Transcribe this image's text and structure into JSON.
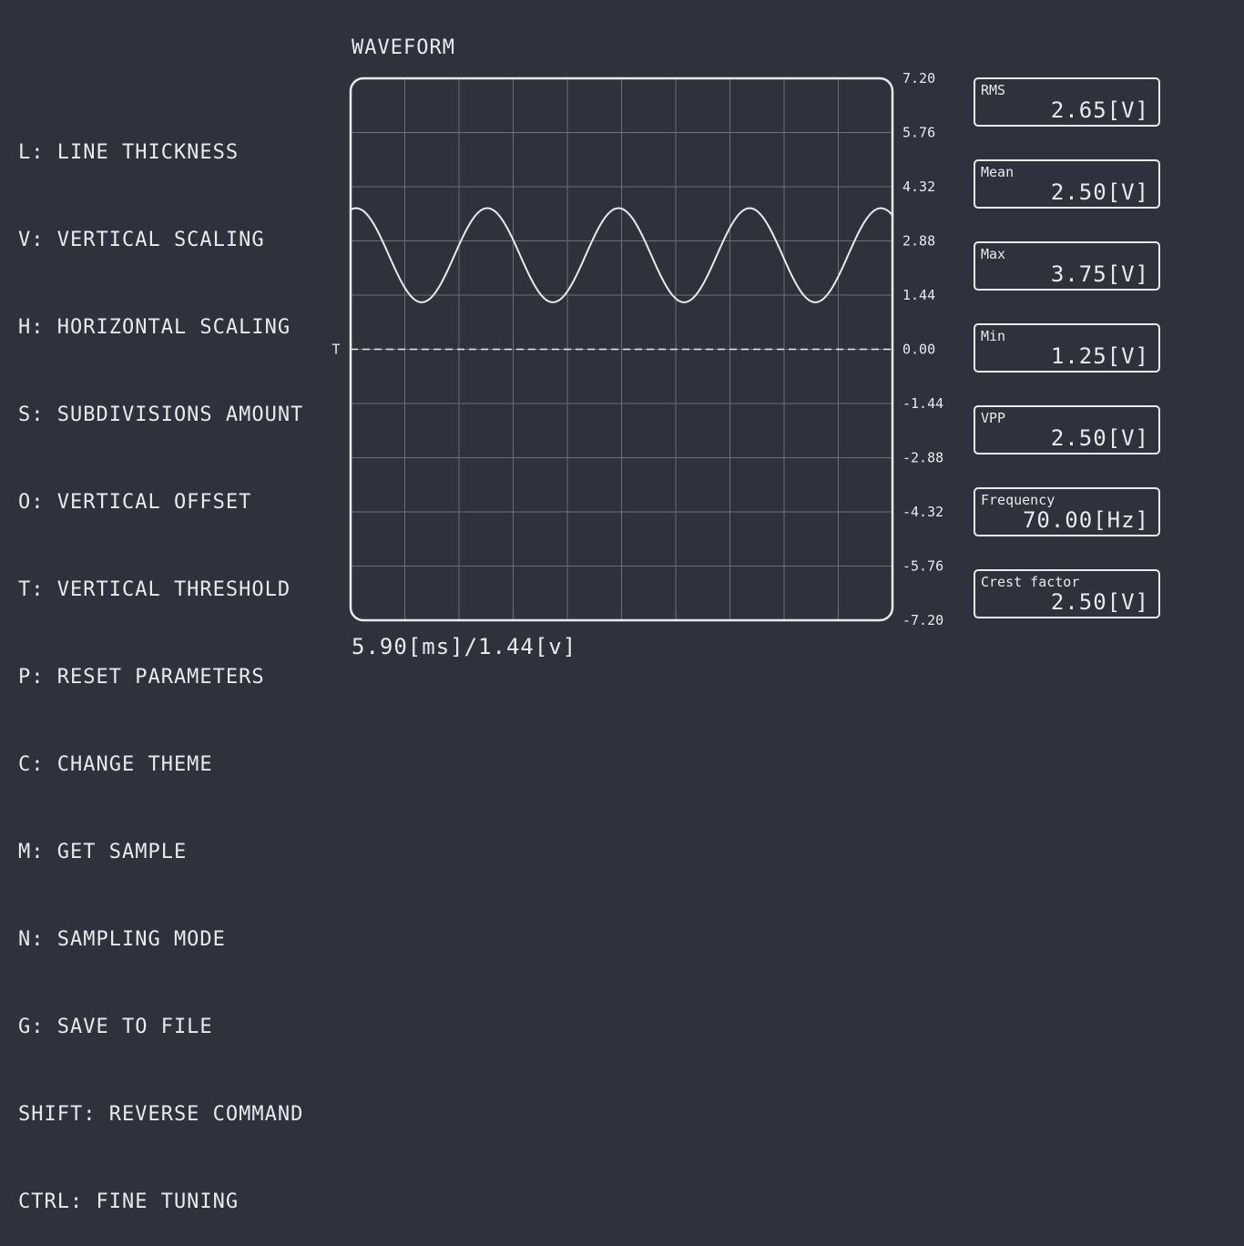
{
  "help_commands": [
    "L: LINE THICKNESS",
    "V: VERTICAL SCALING",
    "H: HORIZONTAL SCALING",
    "S: SUBDIVISIONS AMOUNT",
    "O: VERTICAL OFFSET",
    "T: VERTICAL THRESHOLD",
    "P: RESET PARAMETERS",
    "C: CHANGE THEME",
    "M: GET SAMPLE",
    "N: SAMPLING MODE",
    "G: SAVE TO FILE",
    "SHIFT: REVERSE COMMAND",
    "CTRL: FINE TUNING"
  ],
  "waveform": {
    "title": "WAVEFORM",
    "threshold_marker": "T",
    "scale_readout": "5.90[ms]/1.44[v]",
    "y_ticks": [
      "7.20",
      "5.76",
      "4.32",
      "2.88",
      "1.44",
      "0.00",
      "-1.44",
      "-2.88",
      "-4.32",
      "-5.76",
      "-7.20"
    ]
  },
  "chart_data": {
    "type": "line",
    "title": "WAVEFORM",
    "xlabel": "",
    "ylabel": "",
    "ylim": [
      -7.2,
      7.2
    ],
    "x_divisions": 10,
    "time_per_division_ms": 5.9,
    "volts_per_division": 1.44,
    "grid": true,
    "threshold": 0.0,
    "series": [
      {
        "waveform": "sine",
        "offset": 2.5,
        "amplitude": 1.25,
        "frequency_hz": 70.0,
        "phase_deg": 75
      }
    ]
  },
  "stats": [
    {
      "label": "RMS",
      "value": "2.65[V]"
    },
    {
      "label": "Mean",
      "value": "2.50[V]"
    },
    {
      "label": "Max",
      "value": "3.75[V]"
    },
    {
      "label": "Min",
      "value": "1.25[V]"
    },
    {
      "label": "VPP",
      "value": "2.50[V]"
    },
    {
      "label": "Frequency",
      "value": "70.00[Hz]"
    },
    {
      "label": "Crest factor",
      "value": "2.50[V]"
    }
  ],
  "colors": {
    "background": "#2e323d",
    "foreground": "#e8eaee",
    "grid": "#6b707b"
  }
}
